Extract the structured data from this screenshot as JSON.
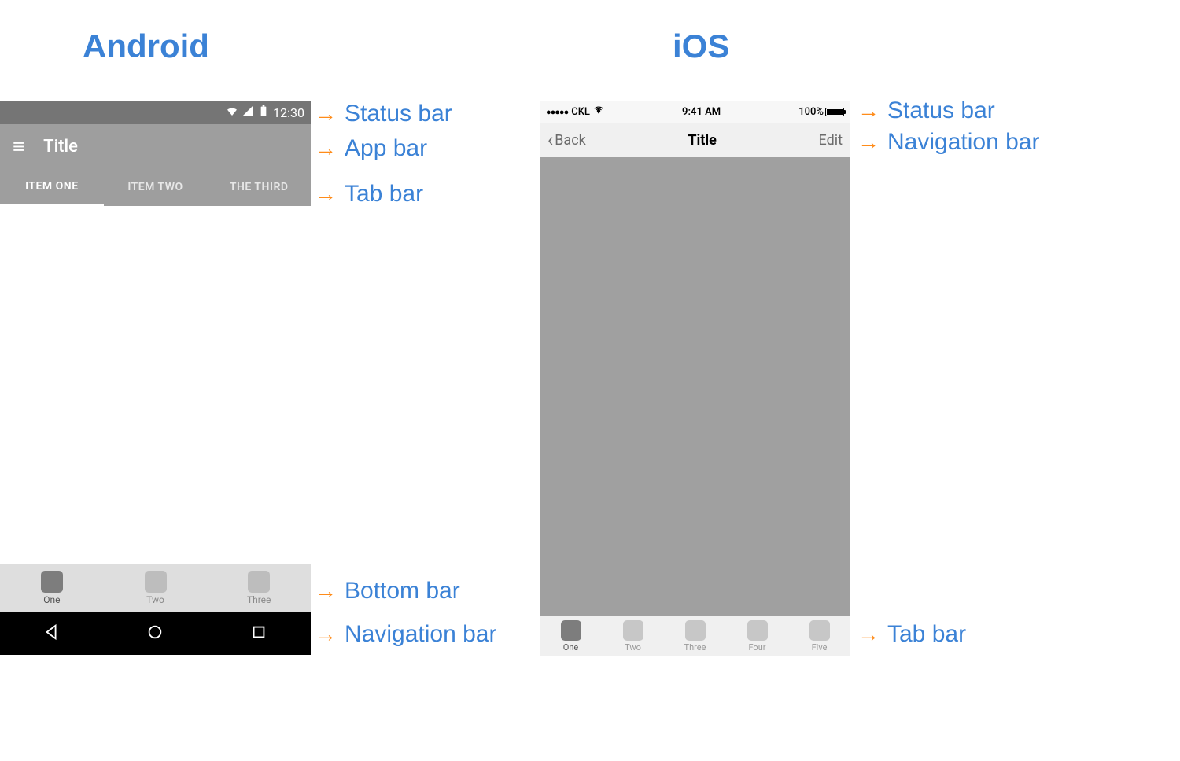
{
  "headings": {
    "android": "Android",
    "ios": "iOS"
  },
  "annotations": {
    "a_status": "Status bar",
    "a_appbar": "App bar",
    "a_tabbar": "Tab bar",
    "a_bottom": "Bottom bar",
    "a_nav": "Navigation bar",
    "i_status": "Status bar",
    "i_navbar": "Navigation bar",
    "i_tabbar": "Tab bar"
  },
  "android": {
    "status": {
      "time": "12:30"
    },
    "appbar": {
      "title": "Title"
    },
    "tabs": [
      "ITEM ONE",
      "ITEM TWO",
      "THE THIRD"
    ],
    "bottom": [
      {
        "label": "One",
        "active": true
      },
      {
        "label": "Two",
        "active": false
      },
      {
        "label": "Three",
        "active": false
      }
    ]
  },
  "ios": {
    "status": {
      "carrier": "CKL",
      "time": "9:41 AM",
      "battery": "100%"
    },
    "navbar": {
      "back": "Back",
      "title": "Title",
      "right": "Edit"
    },
    "tabs": [
      {
        "label": "One",
        "active": true
      },
      {
        "label": "Two",
        "active": false
      },
      {
        "label": "Three",
        "active": false
      },
      {
        "label": "Four",
        "active": false
      },
      {
        "label": "Five",
        "active": false
      }
    ]
  }
}
